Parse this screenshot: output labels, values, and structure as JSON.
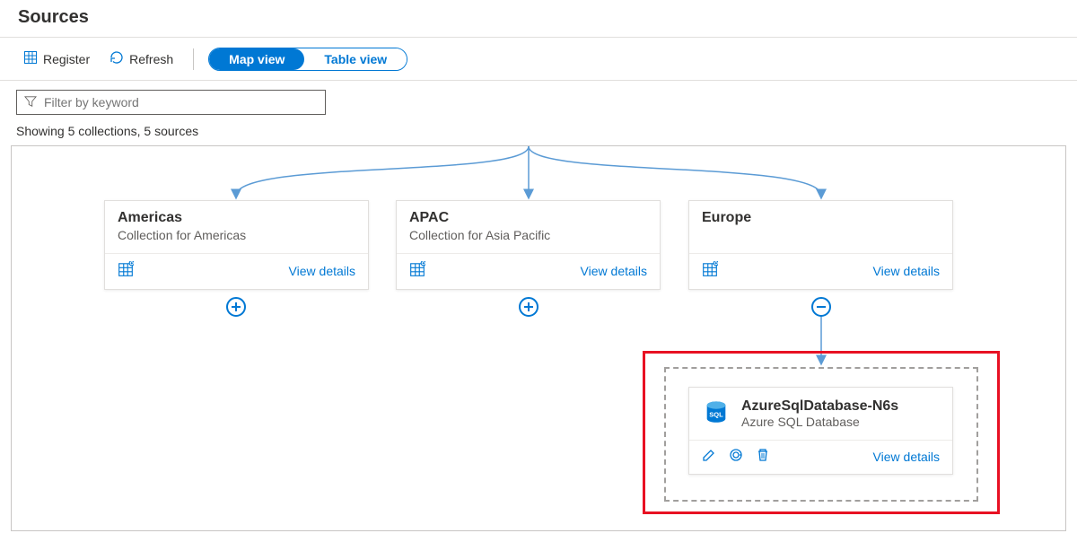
{
  "page": {
    "title": "Sources"
  },
  "toolbar": {
    "register_label": "Register",
    "refresh_label": "Refresh",
    "map_view_label": "Map view",
    "table_view_label": "Table view"
  },
  "filter": {
    "placeholder": "Filter by keyword"
  },
  "summary": "Showing 5 collections, 5 sources",
  "collections": [
    {
      "title": "Americas",
      "subtitle": "Collection for Americas",
      "view_details": "View details",
      "expand_state": "collapsed"
    },
    {
      "title": "APAC",
      "subtitle": "Collection for Asia Pacific",
      "view_details": "View details",
      "expand_state": "collapsed"
    },
    {
      "title": "Europe",
      "subtitle": "",
      "view_details": "View details",
      "expand_state": "expanded"
    }
  ],
  "source": {
    "name": "AzureSqlDatabase-N6s",
    "type": "Azure SQL Database",
    "view_details": "View details"
  }
}
